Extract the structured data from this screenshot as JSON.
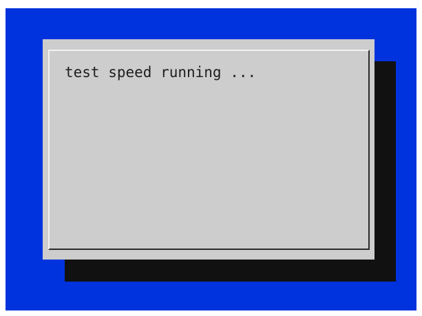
{
  "dialog": {
    "message": "test speed running ..."
  },
  "colors": {
    "background": "#0033dd",
    "dialog": "#cdcdcd",
    "shadow": "#111111",
    "text": "#1e1e1e"
  }
}
